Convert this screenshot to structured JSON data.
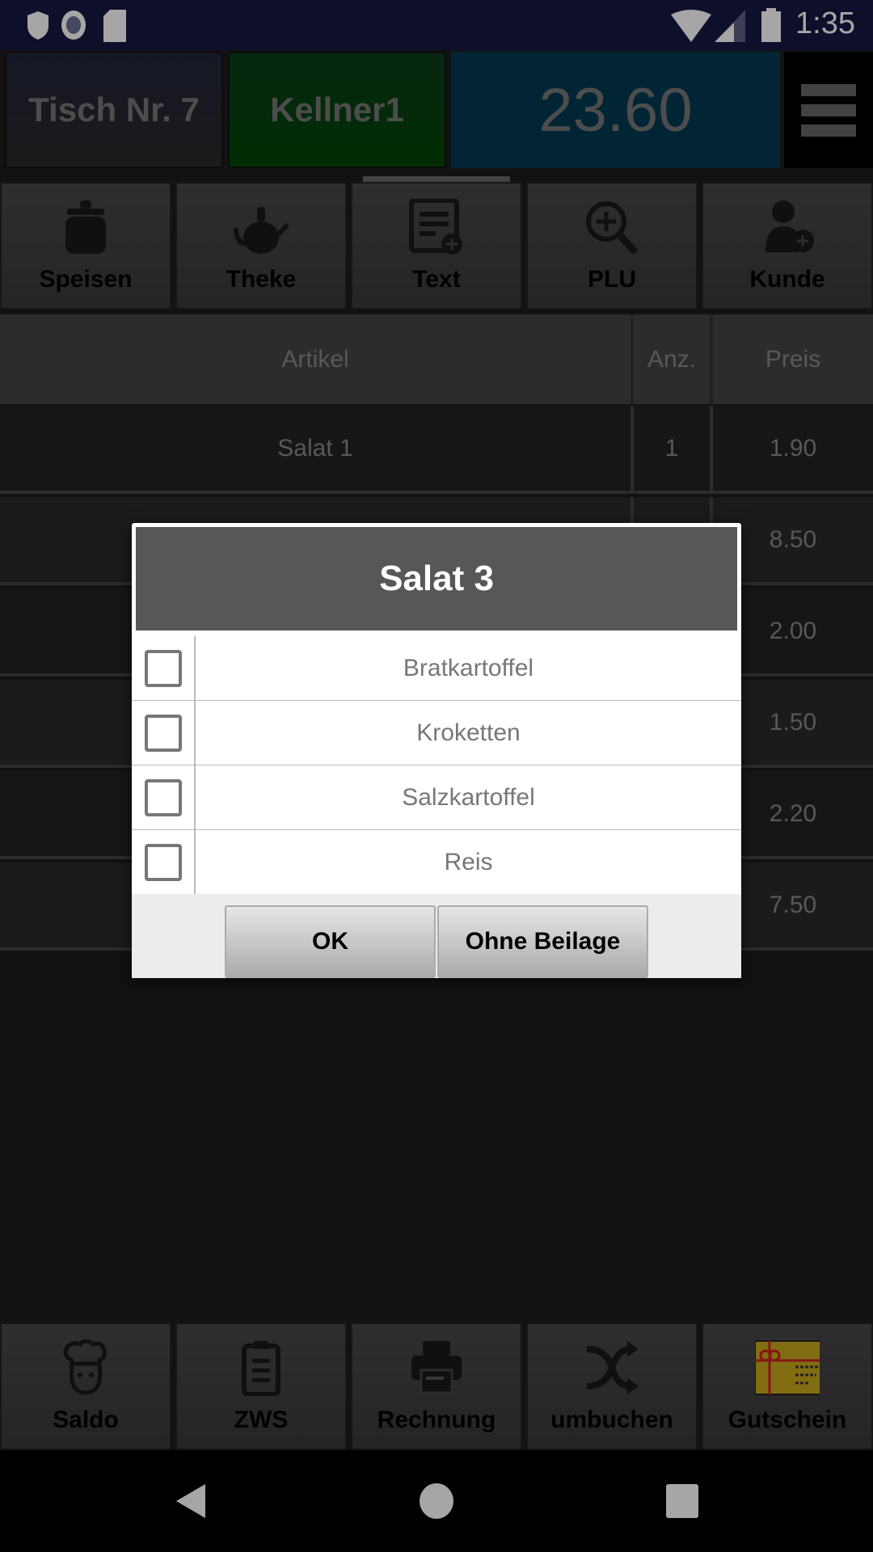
{
  "status_bar": {
    "time": "1:35",
    "icons": [
      "shield-icon",
      "record-icon",
      "sd-card-icon",
      "wifi-icon",
      "signal-icon",
      "battery-icon"
    ]
  },
  "header": {
    "table": "Tisch Nr. 7",
    "waiter": "Kellner1",
    "total": "23.60",
    "menu_icon": "hamburger-menu-icon"
  },
  "toolbar": [
    {
      "label": "Speisen",
      "icon": "pot-icon"
    },
    {
      "label": "Theke",
      "icon": "teapot-icon"
    },
    {
      "label": "Text",
      "icon": "add-list-icon"
    },
    {
      "label": "PLU",
      "icon": "zoom-in-icon"
    },
    {
      "label": "Kunde",
      "icon": "add-user-icon"
    }
  ],
  "table": {
    "headers": [
      "Artikel",
      "Anz.",
      "Preis"
    ],
    "rows": [
      {
        "article": "Salat 1",
        "qty": "1",
        "price": "1.90"
      },
      {
        "price": "8.50"
      },
      {
        "price": "2.00"
      },
      {
        "price": "1.50"
      },
      {
        "price": "2.20"
      },
      {
        "price": "7.50"
      }
    ]
  },
  "dialog": {
    "title": "Salat 3",
    "options": [
      {
        "label": "Bratkartoffel",
        "checked": false
      },
      {
        "label": "Kroketten",
        "checked": false
      },
      {
        "label": "Salzkartoffel",
        "checked": false
      },
      {
        "label": "Reis",
        "checked": false
      }
    ],
    "ok": "OK",
    "no_side": "Ohne Beilage"
  },
  "bottom_bar": [
    {
      "label": "Saldo",
      "icon": "chef-icon"
    },
    {
      "label": "ZWS",
      "icon": "clipboard-icon"
    },
    {
      "label": "Rechnung",
      "icon": "printer-icon"
    },
    {
      "label": "umbuchen",
      "icon": "shuffle-icon"
    },
    {
      "label": "Gutschein",
      "icon": "gift-voucher-icon"
    }
  ],
  "colors": {
    "status_bar": "#141843",
    "waiter_bg": "#034503",
    "total_bg": "#023a51",
    "voucher": "#c8a81e"
  }
}
